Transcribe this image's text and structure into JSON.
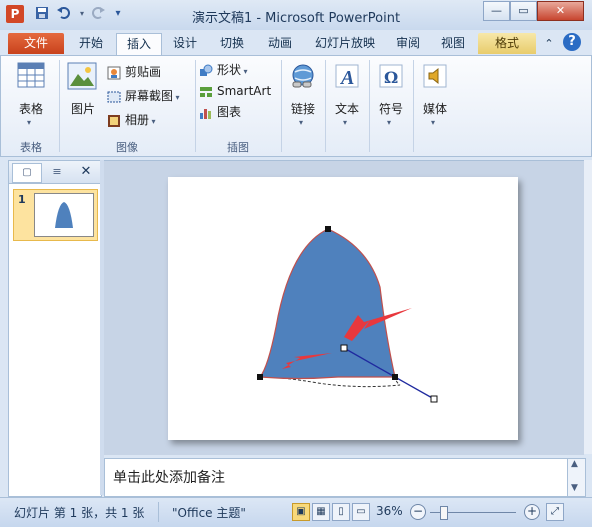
{
  "window": {
    "title": "演示文稿1 - Microsoft PowerPoint",
    "app_icon": "P"
  },
  "quick_access": [
    "save-icon",
    "undo-icon",
    "redo-icon",
    "customize-icon"
  ],
  "window_controls": {
    "minimize": "—",
    "restore": "▭",
    "close": "✕"
  },
  "tabs": [
    {
      "label": "文件"
    },
    {
      "label": "开始"
    },
    {
      "label": "插入"
    },
    {
      "label": "设计"
    },
    {
      "label": "切换"
    },
    {
      "label": "动画"
    },
    {
      "label": "幻灯片放映"
    },
    {
      "label": "审阅"
    },
    {
      "label": "视图"
    },
    {
      "label": "格式"
    }
  ],
  "ribbon": {
    "groups": {
      "tables": {
        "label": "表格",
        "button": "表格"
      },
      "images": {
        "label": "图像",
        "picture": "图片",
        "clipart": "剪贴画",
        "screenshot": "屏幕截图",
        "album": "相册"
      },
      "illustrations": {
        "label": "插图",
        "shapes": "形状",
        "smartart": "SmartArt",
        "chart": "图表"
      },
      "links": {
        "button": "链接"
      },
      "text": {
        "button": "文本"
      },
      "symbols": {
        "button": "符号"
      },
      "media": {
        "button": "媒体"
      }
    }
  },
  "slides_pane": {
    "slide_number": "1"
  },
  "notes": {
    "placeholder": "单击此处添加备注"
  },
  "status": {
    "slide_info": "幻灯片 第 1 张，共 1 张",
    "theme": "\"Office 主题\"",
    "zoom": "36%"
  },
  "colors": {
    "shape_fill": "#4f81bd",
    "shape_outline": "#c0504d",
    "arrow": "#e8383d",
    "ribbon_accent": "#2b579a"
  }
}
